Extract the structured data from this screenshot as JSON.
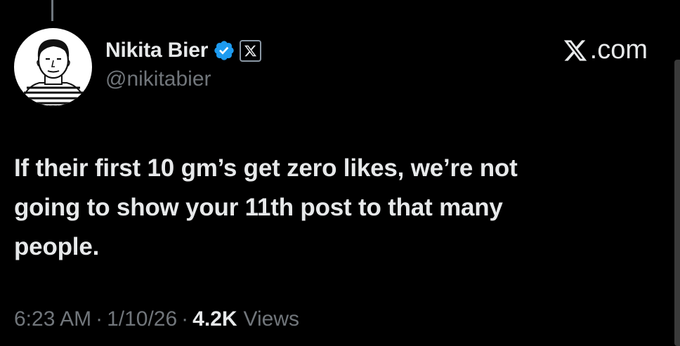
{
  "author": {
    "display_name": "Nikita Bier",
    "handle": "@nikitabier",
    "verified": true,
    "affiliate_badge": "x-logo-icon"
  },
  "brand": {
    "label": ".com",
    "icon": "x-logo-icon"
  },
  "tweet": {
    "text": "If their first 10 gm’s get zero likes, we’re not\ngoing to show your 11th post to that many\npeople.",
    "time": "6:23 AM",
    "date": "1/10/26",
    "separator": "·",
    "views_count": "4.2K",
    "views_label": "Views"
  },
  "colors": {
    "background": "#000000",
    "primary_text": "#e7e9ea",
    "secondary_text": "#71767b",
    "verified_blue": "#1d9bf0"
  }
}
